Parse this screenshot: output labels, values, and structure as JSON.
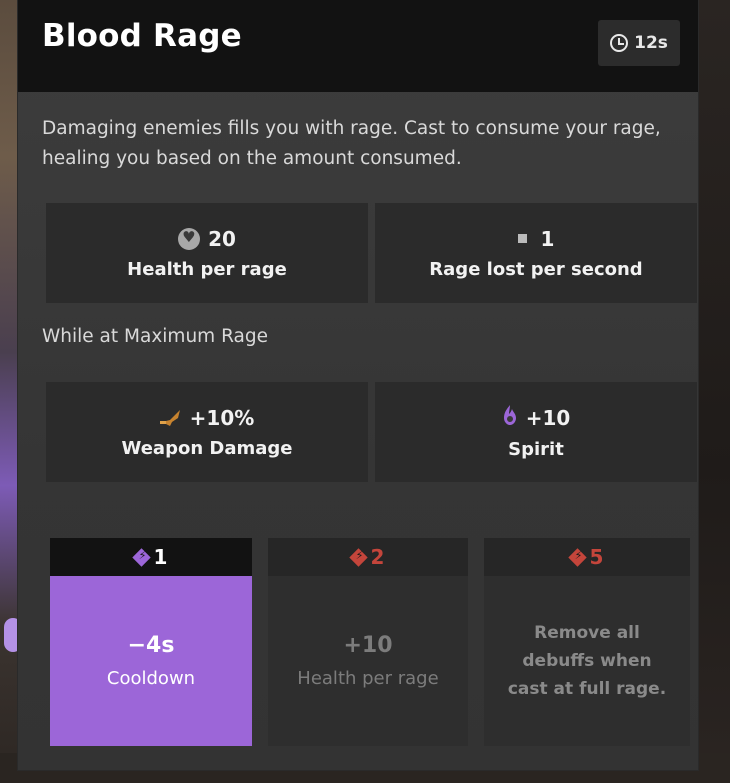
{
  "ability": {
    "name": "Blood Rage",
    "cooldown": "12s",
    "description": "Damaging enemies fills you with rage. Cast to consume your rage, healing you based on the amount consumed."
  },
  "stats": [
    {
      "icon": "heart-icon",
      "value": "20",
      "label": "Health per rage"
    },
    {
      "icon": "square-icon",
      "value": "1",
      "label": "Rage lost per second"
    }
  ],
  "max_rage": {
    "label": "While at Maximum Rage",
    "bonuses": [
      {
        "icon": "weapon-damage-icon",
        "value": "+10%",
        "label": "Weapon Damage"
      },
      {
        "icon": "spirit-flame-icon",
        "value": "+10",
        "label": "Spirit"
      }
    ]
  },
  "upgrades": [
    {
      "cost": "1",
      "color": "#9c66d8",
      "unlocked": true,
      "value": "−4s",
      "label": "Cooldown"
    },
    {
      "cost": "2",
      "color": "#c4453b",
      "unlocked": false,
      "value": "+10",
      "label": "Health per rage"
    },
    {
      "cost": "5",
      "color": "#c4453b",
      "unlocked": false,
      "value": "",
      "label": "Remove all debuffs when cast at full rage."
    }
  ],
  "colors": {
    "accent_purple": "#9c66d8",
    "locked_red": "#c4453b",
    "panel": "#393939",
    "header": "#121212"
  }
}
